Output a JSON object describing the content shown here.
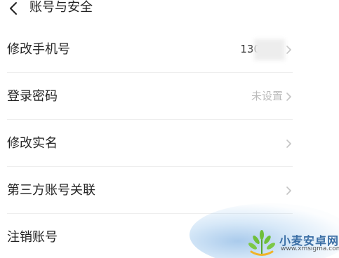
{
  "header": {
    "title": "账号与安全",
    "back_icon": "chevron-left-icon"
  },
  "rows": [
    {
      "label": "修改手机号",
      "value": "130****"
    },
    {
      "label": "登录密码",
      "value": "未设置"
    },
    {
      "label": "修改实名",
      "value": ""
    },
    {
      "label": "第三方账号关联",
      "value": ""
    },
    {
      "label": "注销账号",
      "value": ""
    }
  ],
  "watermark": {
    "title": "小麦安卓网",
    "url": "www.xmsigma.com"
  },
  "colors": {
    "text": "#222222",
    "muted": "#bbbbbb",
    "divider": "#eeeeee",
    "watermark_blue": "#3a6ea5",
    "watermark_green": "#6fbf3a"
  }
}
